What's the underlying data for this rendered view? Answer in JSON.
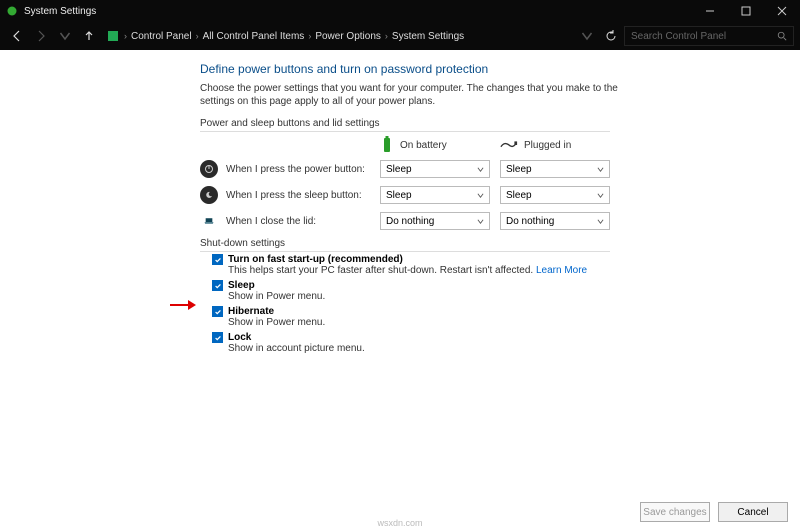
{
  "window": {
    "title": "System Settings"
  },
  "breadcrumb": {
    "root": "Control Panel",
    "level1": "All Control Panel Items",
    "level2": "Power Options",
    "level3": "System Settings"
  },
  "search": {
    "placeholder": "Search Control Panel"
  },
  "heading": "Define power buttons and turn on password protection",
  "description": "Choose the power settings that you want for your computer. The changes that you make to the settings on this page apply to all of your power plans.",
  "section1_title": "Power and sleep buttons and lid settings",
  "columns": {
    "battery": "On battery",
    "plugged": "Plugged in"
  },
  "rows": {
    "power": {
      "label": "When I press the power button:",
      "battery": "Sleep",
      "plugged": "Sleep"
    },
    "sleep": {
      "label": "When I press the sleep button:",
      "battery": "Sleep",
      "plugged": "Sleep"
    },
    "lid": {
      "label": "When I close the lid:",
      "battery": "Do nothing",
      "plugged": "Do nothing"
    }
  },
  "section2_title": "Shut-down settings",
  "shutdown": {
    "faststart": {
      "label": "Turn on fast start-up (recommended)",
      "desc": "This helps start your PC faster after shut-down. Restart isn't affected. ",
      "link": "Learn More"
    },
    "sleep": {
      "label": "Sleep",
      "desc": "Show in Power menu."
    },
    "hibernate": {
      "label": "Hibernate",
      "desc": "Show in Power menu."
    },
    "lock": {
      "label": "Lock",
      "desc": "Show in account picture menu."
    }
  },
  "buttons": {
    "save": "Save changes",
    "cancel": "Cancel"
  },
  "watermark": "wsxdn.com"
}
